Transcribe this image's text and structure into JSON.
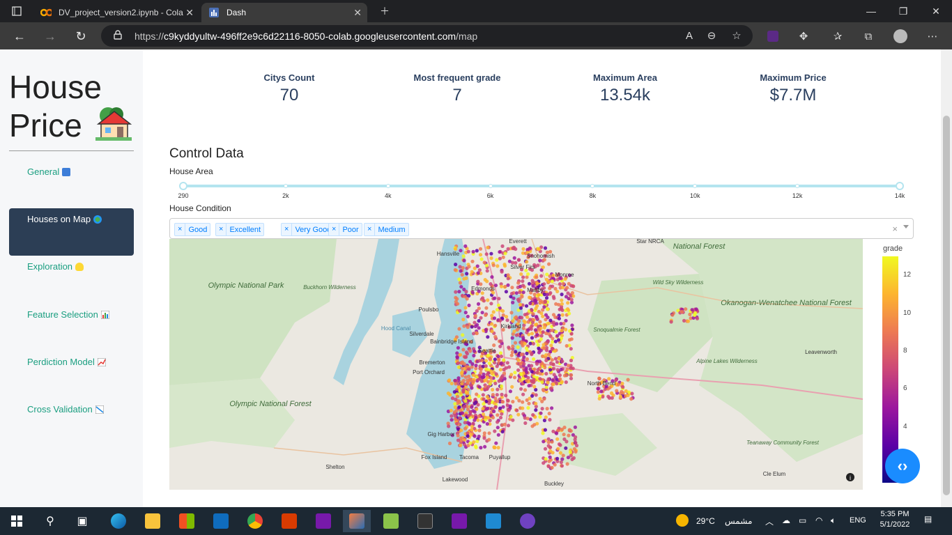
{
  "browser": {
    "tabs": [
      {
        "title": "DV_project_version2.ipynb - Cola",
        "favicon": "colab-icon"
      },
      {
        "title": "Dash",
        "favicon": "dash-icon"
      }
    ],
    "url_prefix": "https://",
    "url_host": "c9kyddyultw-496ff2e9c6d22116-8050-colab.googleusercontent.com",
    "url_path": "/map"
  },
  "sidebar": {
    "title_line1": "House",
    "title_line2": "Price",
    "title_emoji": "🏡",
    "items": [
      {
        "label": "General",
        "icon": "book-icon",
        "active": false
      },
      {
        "label": "Houses on Map",
        "icon": "globe-icon",
        "active": true
      },
      {
        "label": "Exploration",
        "icon": "lightbulb-icon",
        "active": false
      },
      {
        "label": "Feature Selection",
        "icon": "bar-chart-icon",
        "active": false
      },
      {
        "label": "Perdiction Model",
        "icon": "trend-chart-icon",
        "active": false
      },
      {
        "label": "Cross Validation",
        "icon": "scatter-chart-icon",
        "active": false
      }
    ]
  },
  "kpis": [
    {
      "label": "Citys Count",
      "value": "70"
    },
    {
      "label": "Most frequent grade",
      "value": "7"
    },
    {
      "label": "Maximum Area",
      "value": "13.54k"
    },
    {
      "label": "Maximum Price",
      "value": "$7.7M"
    }
  ],
  "controls": {
    "title": "Control Data",
    "area_label": "House Area",
    "area_ticks": [
      "290",
      "2k",
      "4k",
      "6k",
      "8k",
      "10k",
      "12k",
      "14k"
    ],
    "condition_label": "House Condition",
    "condition_values": [
      "Good",
      "Excellent",
      "Very Good",
      "Poor",
      "Medium"
    ],
    "chip_remove": "×",
    "clear_all": "×"
  },
  "map": {
    "colorbar_title": "grade",
    "colorbar_ticks": [
      "12",
      "10",
      "8",
      "6",
      "4"
    ],
    "colorscale": [
      "#f0f921",
      "#fdb42f",
      "#ed7953",
      "#cc4778",
      "#9c179e",
      "#5c01a6",
      "#0d0887"
    ],
    "info_glyph": "i",
    "places": [
      "Everett",
      "Hansville",
      "Snohomish",
      "Silver Firs",
      "Monroe",
      "Edmonds",
      "Maltby",
      "Olympic National Park",
      "Buckhorn Wilderness",
      "Poulsbo",
      "Silverdale",
      "Bainbridge Island",
      "Bremerton",
      "Port Orchard",
      "Gig Harbor",
      "Fox Island",
      "Tacoma",
      "Puyallup",
      "Lakewood",
      "Buckley",
      "Shelton",
      "Olympic National Forest",
      "Hood Canal",
      "Kirkland",
      "Seattle",
      "North Bend",
      "Snoqualmie Forest",
      "Wild Sky Wilderness",
      "Alpine Lakes Wilderness",
      "Okanogan-Wenatchee National Forest",
      "Leavenworth",
      "Cle Elum",
      "Teanaway Community Forest",
      "National Forest",
      "Star NRCA"
    ]
  },
  "embed_button": "‹›",
  "taskbar": {
    "temperature": "29°C",
    "weather": "مشمس",
    "language": "ENG",
    "time": "5:35 PM",
    "date": "5/1/2022"
  }
}
